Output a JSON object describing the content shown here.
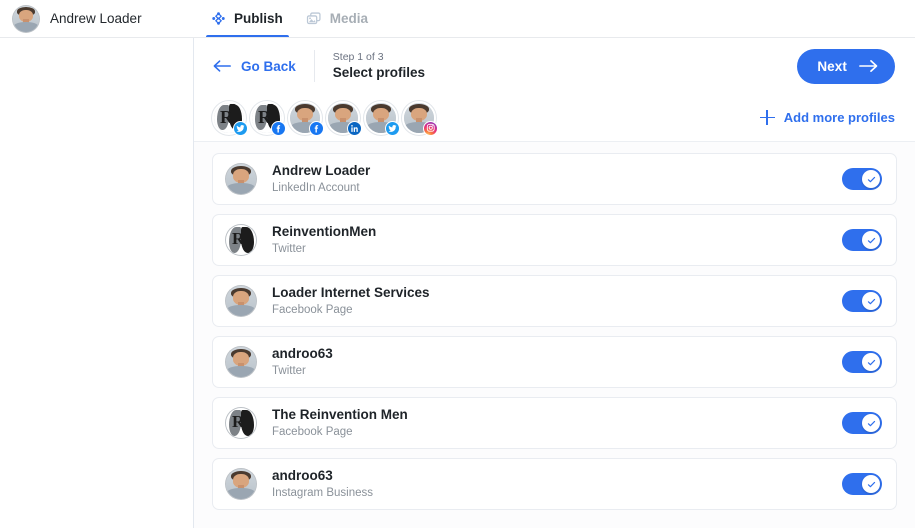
{
  "topbar": {
    "user_name": "Andrew Loader",
    "avatar_icon": "user-avatar-photo",
    "tabs": [
      {
        "label": "Publish",
        "icon": "publish-nodes-icon",
        "active": true
      },
      {
        "label": "Media",
        "icon": "media-images-icon",
        "active": false
      }
    ]
  },
  "wizard": {
    "go_back_label": "Go Back",
    "back_icon": "arrow-left-icon",
    "step_sub": "Step 1 of 3",
    "step_title": "Select profiles",
    "next_label": "Next",
    "next_icon": "arrow-right-icon"
  },
  "strip": {
    "add_more_label": "Add more profiles",
    "add_icon": "plus-icon",
    "avatars": [
      {
        "art": "r-logo",
        "network": "twitter",
        "badge_icon": "twitter-bird-icon"
      },
      {
        "art": "r-logo",
        "network": "facebook",
        "badge_icon": "facebook-f-icon"
      },
      {
        "art": "photo",
        "network": "facebook",
        "badge_icon": "facebook-f-icon"
      },
      {
        "art": "photo",
        "network": "linkedin",
        "badge_icon": "linkedin-in-icon"
      },
      {
        "art": "photo",
        "network": "twitter",
        "badge_icon": "twitter-bird-icon"
      },
      {
        "art": "photo",
        "network": "instagram",
        "badge_icon": "instagram-camera-icon"
      }
    ]
  },
  "profiles": [
    {
      "name": "Andrew Loader",
      "type": "LinkedIn Account",
      "art": "photo",
      "enabled": true
    },
    {
      "name": "ReinventionMen",
      "type": "Twitter",
      "art": "r-logo",
      "enabled": true
    },
    {
      "name": "Loader Internet Services",
      "type": "Facebook Page",
      "art": "photo",
      "enabled": true
    },
    {
      "name": "androo63",
      "type": "Twitter",
      "art": "photo",
      "enabled": true
    },
    {
      "name": "The Reinvention Men",
      "type": "Facebook Page",
      "art": "r-logo",
      "enabled": true
    },
    {
      "name": "androo63",
      "type": "Instagram Business",
      "art": "photo",
      "enabled": true
    }
  ],
  "colors": {
    "accent": "#2f6fed",
    "text_primary": "#1f2429",
    "text_muted": "#8a9199",
    "panel_bg": "#fcfcfd",
    "border": "#e9ecf1"
  }
}
